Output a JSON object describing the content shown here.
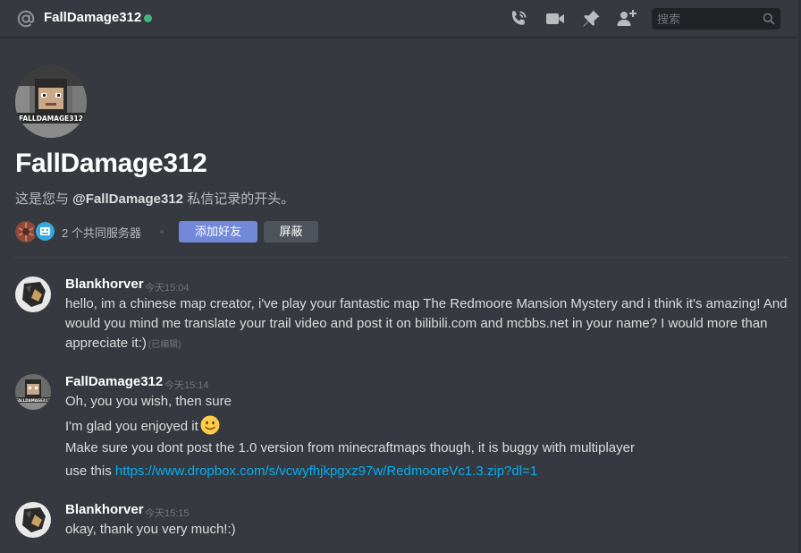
{
  "header": {
    "title": "FallDamage312",
    "status_color": "#43b581",
    "icons": [
      "at-icon",
      "phone-call-icon",
      "video-call-icon",
      "pin-icon",
      "add-friend-icon"
    ],
    "search_placeholder": "搜索"
  },
  "welcome": {
    "title": "FallDamage312",
    "desc_prefix": "这是您与 ",
    "desc_mention": "@FallDamage312",
    "desc_suffix": " 私信记录的开头。",
    "mutual_servers": "2 个共同服务器",
    "add_friend_label": "添加好友",
    "block_label": "屏蔽"
  },
  "messages": [
    {
      "author": "Blankhorver",
      "timestamp": "今天15:04",
      "lines": [
        "hello, im a chinese map creator, i've play your fantastic map The Redmoore Mansion Mystery and i think it's amazing! And",
        "would you mind me translate your trail video and post it on bilibili.com and mcbbs.net in your name? I would more than",
        "appreciate it:)"
      ],
      "edited": "(已编辑)"
    },
    {
      "author": "FallDamage312",
      "timestamp": "今天15:14",
      "lines": [
        "Oh, you you wish, then sure",
        "I'm glad you enjoyed it",
        "Make sure you dont post the 1.0 version from minecraftmaps though, it is buggy with multiplayer",
        "use this "
      ],
      "link": "https://www.dropbox.com/s/vcwyfhjkpgxz97w/RedmooreVc1.3.zip?dl=1"
    },
    {
      "author": "Blankhorver",
      "timestamp": "今天15:15",
      "lines": [
        "okay, thank you very much!:)"
      ]
    }
  ],
  "colors": {
    "background": "#36393f",
    "accent": "#7289da",
    "link": "#00b0f4"
  }
}
